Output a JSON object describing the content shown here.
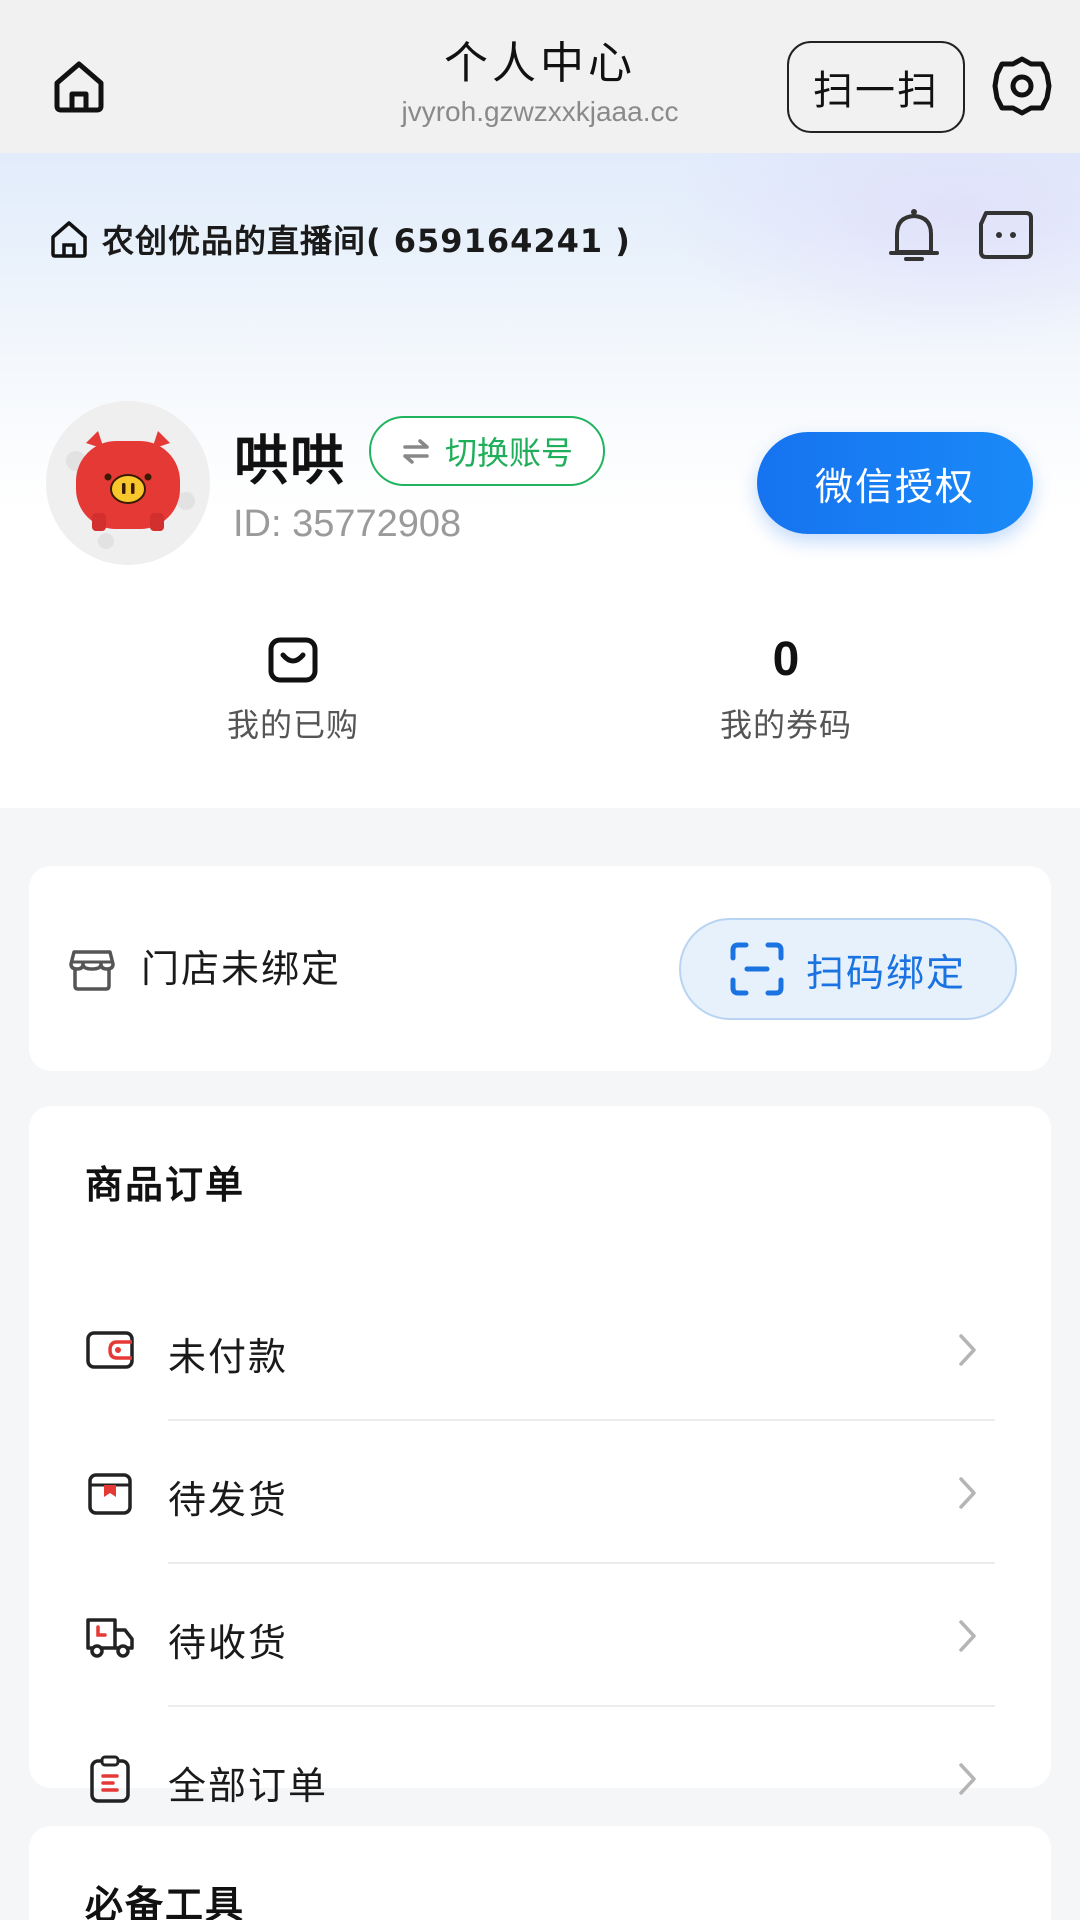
{
  "header": {
    "title": "个人中心",
    "domain": "jvyroh.gzwzxxkjaaa.cc",
    "scan_label": "扫一扫"
  },
  "profile": {
    "room": "农创优品的直播间( 659164241 )",
    "name": "哄哄",
    "switch_label": "切换账号",
    "id_text": "ID: 35772908",
    "wechat_label": "微信授权"
  },
  "stats": [
    {
      "label": "我的已购",
      "icon": "shopping-bag-icon"
    },
    {
      "value": "0",
      "label": "我的券码"
    }
  ],
  "store": {
    "text": "门店未绑定",
    "bind_label": "扫码绑定"
  },
  "orders": {
    "title": "商品订单",
    "items": [
      {
        "label": "未付款",
        "icon": "wallet-icon"
      },
      {
        "label": "待发货",
        "icon": "package-icon"
      },
      {
        "label": "待收货",
        "icon": "truck-icon"
      },
      {
        "label": "全部订单",
        "icon": "clipboard-icon"
      }
    ]
  },
  "tools": {
    "title": "必备工具"
  },
  "colors": {
    "accent": "#1a73e0",
    "green": "#22b35e",
    "red": "#e53935"
  }
}
